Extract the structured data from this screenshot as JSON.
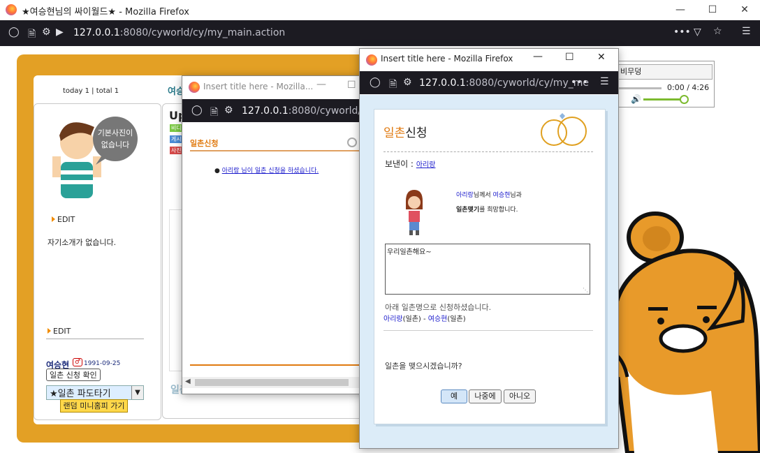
{
  "browser": {
    "window_title": "★여승현님의 싸이월드★ - Mozilla Firefox",
    "url_host": "127.0.0.1",
    "url_rest": ":8080/cyworld/cy/my_main.action"
  },
  "main": {
    "today_total": "today 1 | total 1",
    "title_frag": "여승",
    "avatar_bubble": "기본사진이 없습니다",
    "edit1": "EDIT",
    "intro": "자기소개가 없습니다.",
    "edit2": "EDIT",
    "owner_name": "여승현",
    "owner_birth": "1991-09-25",
    "request_check": "일촌 신청 확인",
    "dropdown_value": "★일촌 파도타기",
    "random_btn": "랜덤 미니홈피 가기",
    "update_frag": "Up",
    "tags": [
      "비디",
      "게시",
      "사진"
    ],
    "ilchon_frag": "일촌평"
  },
  "popup1": {
    "title": "Insert title here - Mozilla...",
    "url_host": "127.0.0.1",
    "url_rest": ":8080/cyworld/c",
    "heading": "일촌신청",
    "item": "아리랑 님이 일촌 신청을 하셨습니다."
  },
  "popup2": {
    "title": "Insert title here - Mozilla Firefox",
    "url_host": "127.0.0.1",
    "url_rest": ":8080/cyworld/cy/my_me",
    "heading_a": "일촌",
    "heading_b": "신청",
    "sender_label": "보낸이 :",
    "sender": "아리랑",
    "msg_name1": "아리랑",
    "msg_mid1": "님께서 ",
    "msg_name2": "여승현",
    "msg_mid2": "님과",
    "msg_bold": "일촌맺기",
    "msg_tail": "를 희망합니다.",
    "textarea_value": "우리일촌해요~",
    "applied_text": "아래 일촌명으로 신청하셨습니다.",
    "applied_name1": "아리랑",
    "applied_rel1": "(일촌) - ",
    "applied_name2": "여승현",
    "applied_rel2": "(일촌)",
    "question": "일촌을 맺으시겠습니까?",
    "btn_yes": "예",
    "btn_later": "나중에",
    "btn_no": "아니오"
  },
  "audio": {
    "track": "비무덩",
    "time": "0:00 / 4:26"
  },
  "colors": {
    "frame_orange": "#e3a025",
    "link_blue": "#1a1acc",
    "heading_orange": "#e07a10",
    "ryan_orange": "#e89a2a"
  }
}
